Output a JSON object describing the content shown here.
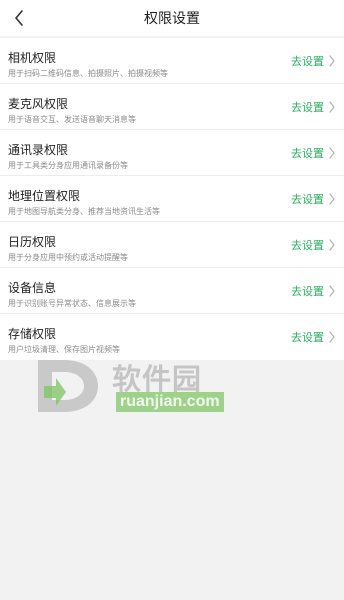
{
  "header": {
    "title": "权限设置"
  },
  "rows": [
    {
      "title": "相机权限",
      "desc": "用于扫码二维码信息、拍摄照片、拍摄视频等",
      "action": "去设置"
    },
    {
      "title": "麦克风权限",
      "desc": "用于语音交互、发送语音聊天消息等",
      "action": "去设置"
    },
    {
      "title": "通讯录权限",
      "desc": "用于工具类分身应用通讯录备份等",
      "action": "去设置"
    },
    {
      "title": "地理位置权限",
      "desc": "用于地图导航类分身、推荐当地资讯生活等",
      "action": "去设置"
    },
    {
      "title": "日历权限",
      "desc": "用于分身应用中预约或活动提醒等",
      "action": "去设置"
    },
    {
      "title": "设备信息",
      "desc": "用于识别账号异常状态、信息展示等",
      "action": "去设置"
    },
    {
      "title": "存储权限",
      "desc": "用户垃圾清理、保存图片视频等",
      "action": "去设置"
    }
  ],
  "watermark": {
    "cn": "软件园",
    "en": "ruanjian.com"
  },
  "colors": {
    "accent": "#29b35e",
    "background": "#f2f2f2"
  },
  "icons": {
    "back": "chevron-left-icon",
    "row_arrow": "chevron-right-icon"
  }
}
